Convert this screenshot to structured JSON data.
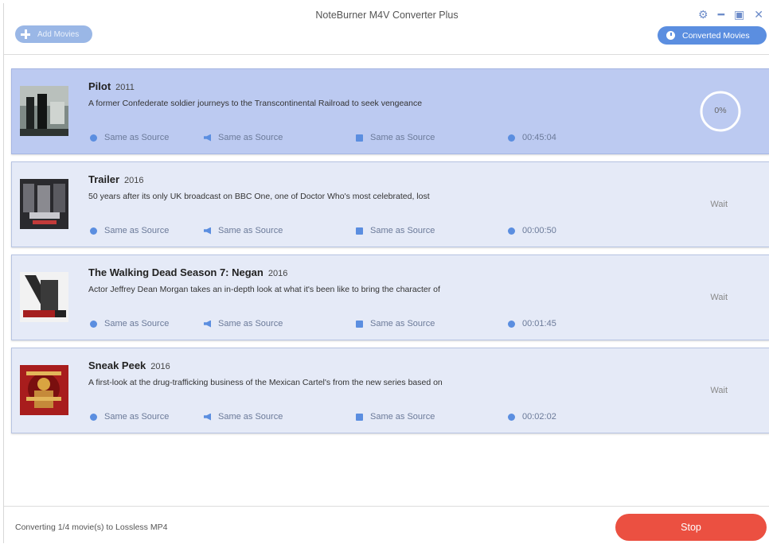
{
  "window": {
    "title": "NoteBurner M4V Converter Plus",
    "add_button_label": "Add Movies",
    "converted_button_label": "Converted Movies",
    "controls": [
      "gear-icon",
      "minimize-icon",
      "maximize-icon",
      "close-icon"
    ]
  },
  "colors": {
    "accent": "#5b8ee0",
    "active_row": "#bccaf1",
    "row": "#e5eaf7",
    "stop": "#eb5041"
  },
  "movies": [
    {
      "title": "Pilot",
      "year": "2011",
      "description": "A former Confederate soldier journeys to the Transcontinental Railroad to seek vengeance",
      "video": "Same as Source",
      "audio": "Same as Source",
      "subtitle": "Same as Source",
      "duration": "00:45:04",
      "status": "0%",
      "progress": 0
    },
    {
      "title": "Trailer",
      "year": "2016",
      "description": "50 years after its only UK broadcast on BBC One, one of Doctor Who's most celebrated, lost",
      "video": "Same as Source",
      "audio": "Same as Source",
      "subtitle": "Same as Source",
      "duration": "00:00:50",
      "status": "Wait"
    },
    {
      "title": "The Walking Dead Season 7: Negan",
      "year": "2016",
      "description": "Actor Jeffrey Dean Morgan takes an in-depth look at what it's been like to bring the character of",
      "video": "Same as Source",
      "audio": "Same as Source",
      "subtitle": "Same as Source",
      "duration": "00:01:45",
      "status": "Wait"
    },
    {
      "title": "Sneak Peek",
      "year": "2016",
      "description": "A first-look at the drug-trafficking business of the Mexican Cartel's from the new series based on",
      "video": "Same as Source",
      "audio": "Same as Source",
      "subtitle": "Same as Source",
      "duration": "00:02:02",
      "status": "Wait"
    }
  ],
  "footer": {
    "status_text": "Converting 1/4 movie(s) to Lossless MP4",
    "stop_label": "Stop"
  }
}
